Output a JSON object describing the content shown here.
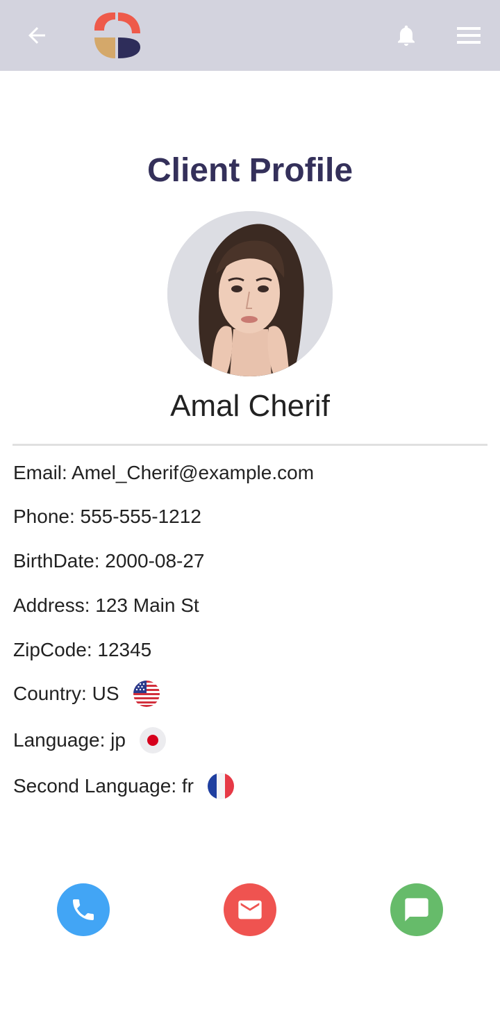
{
  "header": {
    "back_icon": "arrow-left-icon",
    "logo": "app-logo",
    "notification_icon": "bell-icon",
    "menu_icon": "hamburger-menu-icon",
    "background": "#d3d3de"
  },
  "page": {
    "title": "Client Profile",
    "title_color": "#34305a"
  },
  "client": {
    "name": "Amal Cherif",
    "fields": [
      {
        "label": "Email: Amel_Cherif@example.com"
      },
      {
        "label": "Phone: 555-555-1212"
      },
      {
        "label": "BirthDate: 2000-08-27"
      },
      {
        "label": "Address: 123 Main St"
      },
      {
        "label": "ZipCode: 12345"
      },
      {
        "label": "Country: US",
        "flag": "us-flag-icon"
      },
      {
        "label": "Language: jp",
        "flag": "japan-flag-icon"
      },
      {
        "label": "Second Language: fr",
        "flag": "france-flag-icon"
      }
    ]
  },
  "actions": {
    "call": {
      "icon": "phone-icon",
      "color": "#42a5f5"
    },
    "email": {
      "icon": "mail-icon",
      "color": "#ef5350"
    },
    "message": {
      "icon": "chat-icon",
      "color": "#66bb6a"
    }
  }
}
